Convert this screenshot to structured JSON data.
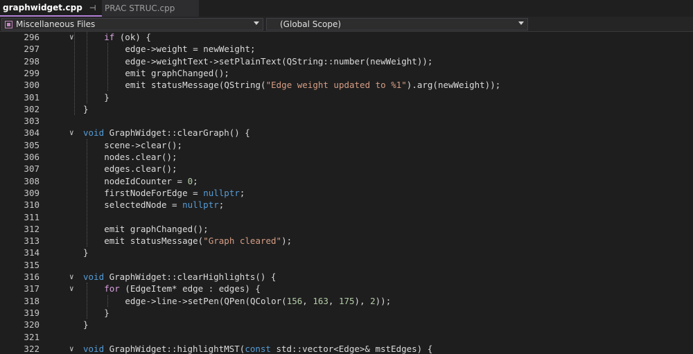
{
  "tabs": [
    {
      "label": "graphwidget.cpp",
      "active": true,
      "pin_glyph": "⊣",
      "close_glyph": "✕"
    },
    {
      "label": "PRAC STRUC.cpp",
      "active": false
    }
  ],
  "navbar": {
    "project": "Miscellaneous Files",
    "scope": "(Global Scope)"
  },
  "colors": {
    "keyword": "#569cd6",
    "control": "#d8a0df",
    "string": "#d69d85",
    "number": "#b5cea8",
    "function": "#dcdcaa",
    "type": "#4ec9b0",
    "accent": "#b180d7"
  },
  "editor": {
    "lines": [
      {
        "n": "296",
        "fold": "∨",
        "indent": 4,
        "tokens": [
          [
            "ctl",
            "if"
          ],
          [
            "v",
            " (ok) {"
          ]
        ]
      },
      {
        "n": "297",
        "indent": 8,
        "tokens": [
          [
            "v",
            "edge->weight = newWeight;"
          ]
        ]
      },
      {
        "n": "298",
        "indent": 8,
        "tokens": [
          [
            "v",
            "edge->weightText->setPlainText(QString::number(newWeight));"
          ]
        ]
      },
      {
        "n": "299",
        "indent": 8,
        "tokens": [
          [
            "v",
            "emit graphChanged();"
          ]
        ]
      },
      {
        "n": "300",
        "indent": 8,
        "tokens": [
          [
            "v",
            "emit statusMessage(QString("
          ],
          [
            "str",
            "\"Edge weight updated to %1\""
          ],
          [
            "v",
            ").arg(newWeight));"
          ]
        ]
      },
      {
        "n": "301",
        "indent": 4,
        "tokens": [
          [
            "v",
            "}"
          ]
        ]
      },
      {
        "n": "302",
        "indent": 0,
        "tokens": [
          [
            "v",
            "}"
          ]
        ]
      },
      {
        "n": "303",
        "indent": 0,
        "tokens": []
      },
      {
        "n": "304",
        "fold": "∨",
        "indent": 0,
        "tokens": [
          [
            "kw",
            "void"
          ],
          [
            "v",
            " GraphWidget::clearGraph() {"
          ]
        ]
      },
      {
        "n": "305",
        "indent": 4,
        "tokens": [
          [
            "v",
            "scene->clear();"
          ]
        ]
      },
      {
        "n": "306",
        "indent": 4,
        "tokens": [
          [
            "v",
            "nodes.clear();"
          ]
        ]
      },
      {
        "n": "307",
        "indent": 4,
        "tokens": [
          [
            "v",
            "edges.clear();"
          ]
        ]
      },
      {
        "n": "308",
        "indent": 4,
        "tokens": [
          [
            "v",
            "nodeIdCounter = "
          ],
          [
            "num",
            "0"
          ],
          [
            "v",
            ";"
          ]
        ]
      },
      {
        "n": "309",
        "indent": 4,
        "tokens": [
          [
            "v",
            "firstNodeForEdge = "
          ],
          [
            "kw",
            "nullptr"
          ],
          [
            "v",
            ";"
          ]
        ]
      },
      {
        "n": "310",
        "indent": 4,
        "tokens": [
          [
            "v",
            "selectedNode = "
          ],
          [
            "kw",
            "nullptr"
          ],
          [
            "v",
            ";"
          ]
        ]
      },
      {
        "n": "311",
        "indent": 0,
        "tokens": []
      },
      {
        "n": "312",
        "indent": 4,
        "tokens": [
          [
            "v",
            "emit graphChanged();"
          ]
        ]
      },
      {
        "n": "313",
        "indent": 4,
        "tokens": [
          [
            "v",
            "emit statusMessage("
          ],
          [
            "str",
            "\"Graph cleared\""
          ],
          [
            "v",
            ");"
          ]
        ]
      },
      {
        "n": "314",
        "indent": 0,
        "tokens": [
          [
            "v",
            "}"
          ]
        ]
      },
      {
        "n": "315",
        "indent": 0,
        "tokens": []
      },
      {
        "n": "316",
        "fold": "∨",
        "indent": 0,
        "tokens": [
          [
            "kw",
            "void"
          ],
          [
            "v",
            " GraphWidget::clearHighlights() {"
          ]
        ]
      },
      {
        "n": "317",
        "fold": "∨",
        "indent": 4,
        "tokens": [
          [
            "ctl",
            "for"
          ],
          [
            "v",
            " (EdgeItem* edge : edges) {"
          ]
        ]
      },
      {
        "n": "318",
        "indent": 8,
        "tokens": [
          [
            "v",
            "edge->line->setPen(QPen(QColor("
          ],
          [
            "num",
            "156"
          ],
          [
            "v",
            ", "
          ],
          [
            "num",
            "163"
          ],
          [
            "v",
            ", "
          ],
          [
            "num",
            "175"
          ],
          [
            "v",
            "), "
          ],
          [
            "num",
            "2"
          ],
          [
            "v",
            "));"
          ]
        ]
      },
      {
        "n": "319",
        "indent": 4,
        "tokens": [
          [
            "v",
            "}"
          ]
        ]
      },
      {
        "n": "320",
        "indent": 0,
        "tokens": [
          [
            "v",
            "}"
          ]
        ]
      },
      {
        "n": "321",
        "indent": 0,
        "tokens": []
      },
      {
        "n": "322",
        "fold": "∨",
        "indent": 0,
        "tokens": [
          [
            "kw",
            "void"
          ],
          [
            "v",
            " GraphWidget::highlightMST("
          ],
          [
            "kw",
            "const"
          ],
          [
            "v",
            " std::vector<Edge>& mstEdges) {"
          ]
        ]
      }
    ]
  }
}
